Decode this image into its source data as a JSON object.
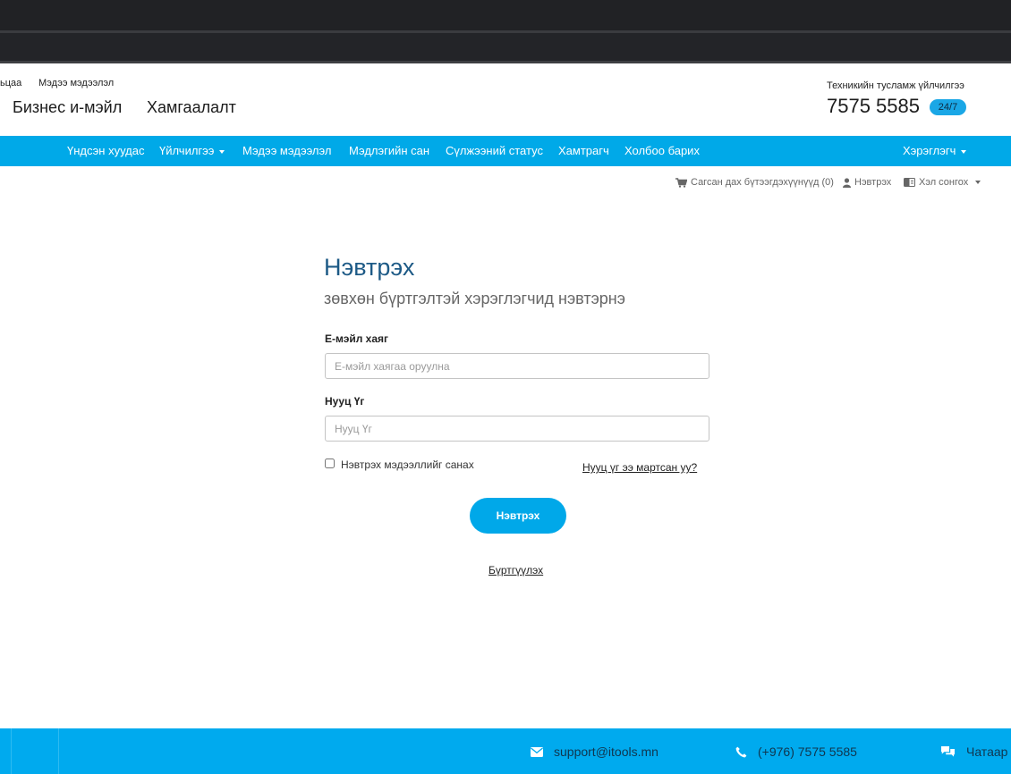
{
  "header": {
    "top_links": [
      "ьцаа",
      "Мэдээ мэдээлэл"
    ],
    "main_links": [
      "Бизнес и-мэйл",
      "Хамгаалалт"
    ],
    "support_label": "Техникийн тусламж үйлчилгээ",
    "support_phone": "7575 5585",
    "support_badge": "24/7"
  },
  "nav": {
    "items": [
      "Үндсэн хуудас",
      "Үйлчилгээ",
      "Мэдээ мэдээлэл",
      "Мэдлэгийн сан",
      "Сүлжээний статус",
      "Хамтрагч",
      "Холбоо барих"
    ],
    "user_menu": "Хэрэглэгч"
  },
  "utility": {
    "cart": "Сагсан дах бүтээгдэхүүнүүд (0)",
    "login": "Нэвтрэх",
    "language": "Хэл сонгох"
  },
  "login": {
    "title": "Нэвтрэх",
    "subtitle": "зөвхөн бүртгэлтэй хэрэглэгчид нэвтэрнэ",
    "email_label": "Е-мэйл хаяг",
    "email_placeholder": "Е-мэйл хаягаа оруулна",
    "email_value": "",
    "password_label": "Нууц Үг",
    "password_placeholder": "Нууц Үг",
    "password_value": "",
    "remember_label": "Нэвтрэх мэдээллийг санах",
    "remember_checked": false,
    "forgot_link": "Нууц үг ээ мартсан уу?",
    "submit_label": "Нэвтрэх",
    "register_link": "Бүртгүүлэх"
  },
  "footer": {
    "email": "support@itools.mn",
    "phone": "(+976) 7575 5585",
    "chat": "Чатаар"
  },
  "colors": {
    "accent": "#00a9e8",
    "title": "#1d5a86",
    "dark_bar": "#212225"
  }
}
